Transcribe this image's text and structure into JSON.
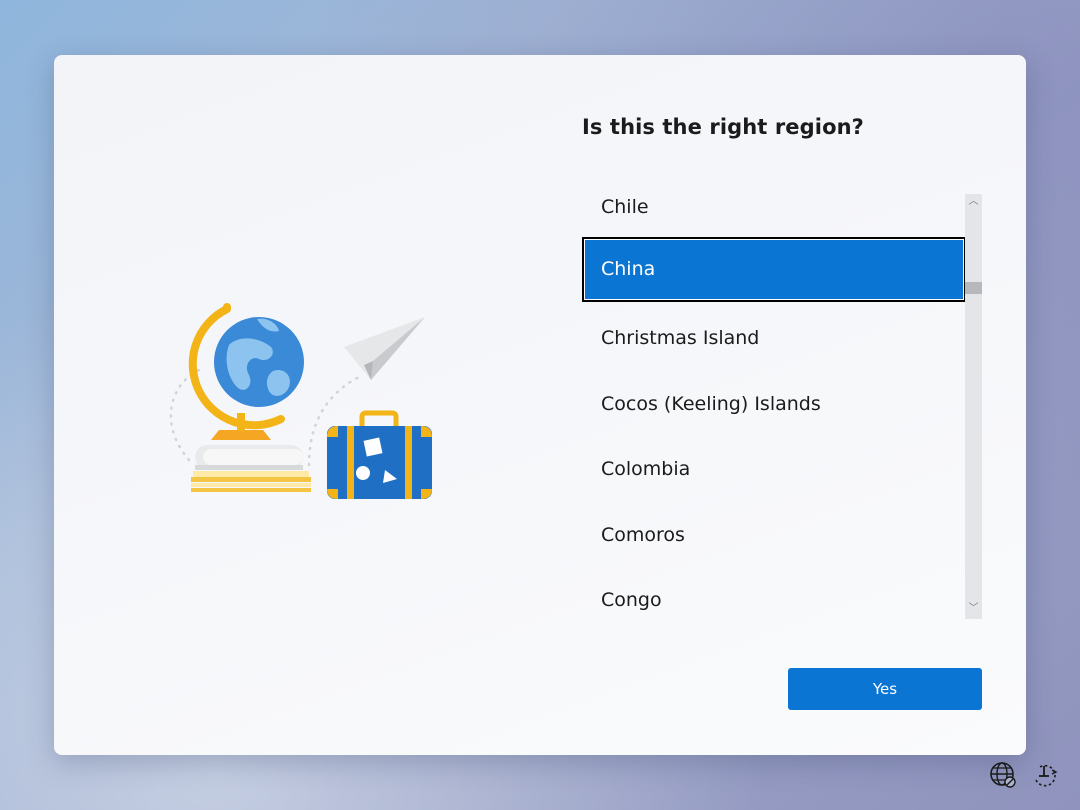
{
  "title": "Is this the right region?",
  "regions": {
    "items": [
      {
        "label": "Chile",
        "selected": false
      },
      {
        "label": "China",
        "selected": true
      },
      {
        "label": "Christmas Island",
        "selected": false
      },
      {
        "label": "Cocos (Keeling) Islands",
        "selected": false
      },
      {
        "label": "Colombia",
        "selected": false
      },
      {
        "label": "Comoros",
        "selected": false
      },
      {
        "label": "Congo",
        "selected": false
      }
    ]
  },
  "scrollbar": {
    "up_glyph": "︿",
    "down_glyph": "﹀"
  },
  "buttons": {
    "yes_label": "Yes"
  },
  "icons": {
    "illustration": "globe-books-suitcase-paper-plane",
    "tray_left": "globe-network-icon",
    "tray_right": "accessibility-icon"
  },
  "colors": {
    "accent": "#0b75d3",
    "text": "#1b1b1b",
    "globe_ring": "#f2b416",
    "globe_blue": "#2f7dd1",
    "suitcase": "#1f6fc4"
  }
}
